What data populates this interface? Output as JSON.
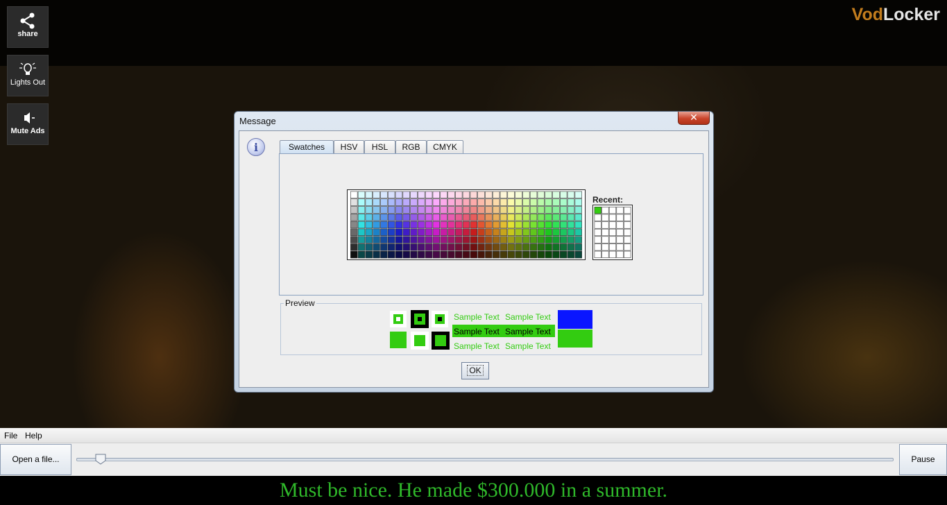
{
  "brand": {
    "logo_part1": "Vod",
    "logo_part2": "Locker"
  },
  "side_buttons": [
    {
      "label": "share",
      "icon": "share-icon"
    },
    {
      "label": "Lights Out",
      "icon": "lightbulb-icon"
    },
    {
      "label": "Mute Ads",
      "icon": "speaker-mute-icon"
    }
  ],
  "dialog": {
    "title": "Message",
    "close_glyph": "✕",
    "info_glyph": "i",
    "tabs": [
      "Swatches",
      "HSV",
      "HSL",
      "RGB",
      "CMYK"
    ],
    "selected_tab": "Swatches",
    "recent_label": "Recent:",
    "preview_label": "Preview",
    "sample_text": "Sample Text",
    "ok_label": "OK",
    "colors": {
      "selected": "#33cc11",
      "preview_bg": "#0a16ff"
    }
  },
  "menubar": {
    "file": "File",
    "help": "Help"
  },
  "controls": {
    "open_label": "Open a file...",
    "pause_label": "Pause",
    "seek_position": 0.03
  },
  "subtitle": "Must be nice. He made $300.000 in a summer."
}
